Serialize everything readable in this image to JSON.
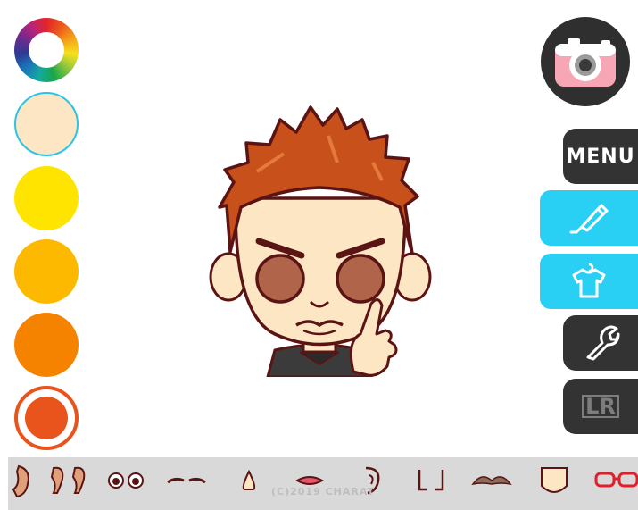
{
  "colors": {
    "skin": "#fde6c3",
    "yellow": "#ffe400",
    "amber": "#fdb900",
    "orange": "#f58300",
    "red_orange": "#e8541c",
    "hair": "#c8501a",
    "eye": "#b0644a",
    "outline": "#5a1414",
    "accent_blue": "#29d0f4",
    "dark_button": "#333333"
  },
  "palette": {
    "swatches": [
      {
        "name": "color-wheel",
        "selected": false
      },
      {
        "name": "skin",
        "color": "#fde6c3",
        "selected": true
      },
      {
        "name": "yellow",
        "color": "#ffe400",
        "selected": false
      },
      {
        "name": "amber",
        "color": "#fdb900",
        "selected": false
      },
      {
        "name": "orange",
        "color": "#f58300",
        "selected": false
      },
      {
        "name": "red-orange",
        "color": "#e8541c",
        "selected": false
      }
    ]
  },
  "toolbar": {
    "camera_icon": "camera-icon",
    "menu_label": "MENU",
    "paint_icon": "paint-tube-icon",
    "shirt_icon": "shirt-icon",
    "settings_icon": "wrench-icon",
    "lr_label": "LR"
  },
  "parts_bar": {
    "items": [
      "hair",
      "ears",
      "eyes",
      "eyebrows",
      "nose",
      "mouth",
      "ear-side",
      "cheeks",
      "mustache",
      "face-shape",
      "glasses"
    ],
    "copyright": "(C)2019 CHARAT"
  }
}
